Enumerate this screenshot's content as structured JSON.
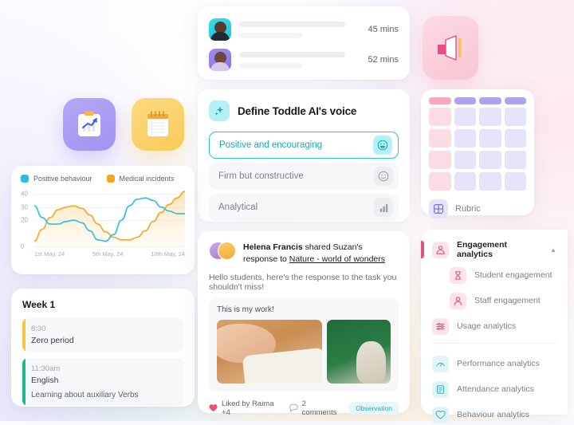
{
  "sessions_card": {
    "name": "sessions-list",
    "rows": [
      {
        "avatar": "avatar-cyan",
        "duration": "45 mins"
      },
      {
        "avatar": "avatar-purple",
        "duration": "52 mins"
      }
    ]
  },
  "megaphone_tile": {
    "icon": "megaphone-icon"
  },
  "app_tiles": [
    {
      "name": "analytics-clipboard-tile",
      "icon": "clipboard-chart-icon"
    },
    {
      "name": "notes-tile",
      "icon": "notepad-icon"
    }
  ],
  "voice_card": {
    "icon": "sparkle-icon",
    "title": "Define Toddle AI's voice",
    "options": [
      {
        "label": "Positive and encouraging",
        "icon": "grinning-face-icon",
        "selected": true
      },
      {
        "label": "Firm but constructive",
        "icon": "neutral-face-icon",
        "selected": false
      },
      {
        "label": "Analytical",
        "icon": "bar-chart-icon",
        "selected": false
      }
    ]
  },
  "rubric_card": {
    "label": "Rubric",
    "icon": "grid-icon",
    "columns": 4,
    "rows": 4,
    "colors": {
      "header_pink": "#f7a8bb",
      "header_purple": "#aaa3ef",
      "body_pink": "#fbdce4",
      "body_purple": "#e6e4fb"
    }
  },
  "chart_card": {
    "chart_data": {
      "type": "line",
      "title": "",
      "xlabel": "",
      "ylabel": "",
      "grid": true,
      "legend_position": "top-left",
      "ylim": [
        0,
        45
      ],
      "yticks": [
        0,
        20,
        30,
        40
      ],
      "x": [
        "1st May, 24",
        "5th May, 24",
        "10th May, 24"
      ],
      "xtick_labels": [
        "1st May, 24",
        "5th May, 24",
        "10th May, 24"
      ],
      "series": [
        {
          "name": "Positive behaviour",
          "color": "#29c0d8",
          "values": [
            31,
            22,
            17,
            17,
            19,
            20,
            18,
            12,
            5,
            4,
            9,
            20,
            31,
            36,
            37,
            35,
            30,
            27,
            25,
            25
          ]
        },
        {
          "name": "Medical incidents",
          "color": "#f5a623",
          "values": [
            4,
            13,
            22,
            28,
            30,
            31,
            29,
            24,
            17,
            11,
            7,
            5,
            5,
            7,
            12,
            19,
            26,
            32,
            37,
            42
          ]
        }
      ]
    }
  },
  "week_card": {
    "title": "Week 1",
    "slots": [
      {
        "accent": "amber",
        "time": "8:30",
        "name": "Zero period",
        "desc": ""
      },
      {
        "accent": "green",
        "time": "11:30am",
        "name": "English",
        "desc": "Learning about auxiliary Verbs"
      }
    ]
  },
  "post_card": {
    "author": "Helena Francis",
    "title_prefix": "Helena Francis",
    "title_middle": " shared Suzan's response to ",
    "title_link": "Nature - world of wonders",
    "body": "Hello students, here's the response to the task you shouldn't miss!",
    "work_label": "This is my work!",
    "photos": [
      {
        "name": "photo-painting-hand",
        "alt": "hand painting on paper"
      },
      {
        "name": "photo-vase-green",
        "alt": "ceramic vase on green backdrop"
      }
    ],
    "likes": "Liked by Raima +4",
    "comments": "2 comments",
    "tag": "Observation",
    "like_icon": "heart-icon",
    "comment_icon": "comment-bubble-icon"
  },
  "analytics_panel": {
    "items": [
      {
        "label": "Engagement analytics",
        "icon": "engagement-icon",
        "tone": "pink",
        "active": true,
        "sub": false,
        "chevron": "collapse-chevron-icon"
      },
      {
        "label": "Student engagement",
        "icon": "student-icon",
        "tone": "pink",
        "active": false,
        "sub": true
      },
      {
        "label": "Staff engagement",
        "icon": "staff-icon",
        "tone": "pink",
        "active": false,
        "sub": true
      },
      {
        "label": "Usage analytics",
        "icon": "sliders-icon",
        "tone": "pink",
        "active": false,
        "sub": false
      },
      {
        "label": "Performance analytics",
        "icon": "gauge-icon",
        "tone": "blue",
        "active": false,
        "sub": false
      },
      {
        "label": "Attendance analytics",
        "icon": "attendance-list-icon",
        "tone": "blue",
        "active": false,
        "sub": false
      },
      {
        "label": "Behaviour analytics",
        "icon": "heart-outline-icon",
        "tone": "blue",
        "active": false,
        "sub": false
      }
    ],
    "accent_color": "#e0537c"
  }
}
